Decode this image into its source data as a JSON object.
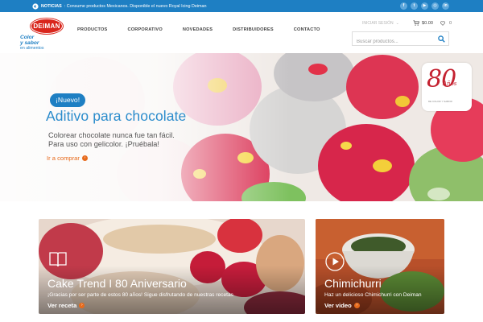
{
  "colors": {
    "brand_blue": "#1e7fc3",
    "brand_red": "#d9261c",
    "accent_orange": "#e76b1c",
    "title_blue": "#2b8ccc"
  },
  "topbar": {
    "news_label": "NOTICIAS",
    "news_text": ": Consume productos Mexicanos. Disponible el nuevo Royal Icing Deiman",
    "socials": [
      {
        "icon": "facebook-icon",
        "glyph": "f"
      },
      {
        "icon": "twitter-icon",
        "glyph": "t"
      },
      {
        "icon": "youtube-icon",
        "glyph": "▶"
      },
      {
        "icon": "instagram-icon",
        "glyph": "◎"
      },
      {
        "icon": "linkedin-icon",
        "glyph": "in"
      }
    ]
  },
  "header": {
    "logo": {
      "brand": "DEIMAN",
      "tagline_1": "Color",
      "tagline_2": "y sabor",
      "tagline_3": "en alimentos"
    },
    "nav": [
      "PRODUCTOS",
      "CORPORATIVO",
      "NOVEDADES",
      "DISTRIBUIDORES",
      "CONTACTO"
    ],
    "login_label": "INICIAR SESIÓN",
    "cart_total": "$0.00",
    "wishlist_count": "0",
    "search_placeholder": "Buscar productos..."
  },
  "hero": {
    "badge": "¡Nuevo!",
    "title": "Aditivo para chocolate",
    "text_line1": "Colorear chocolate nunca fue tan fácil.",
    "text_line2": "Para uso con gelicolor. ¡Pruébala!",
    "cta": "Ir a comprar",
    "anniversary": {
      "number": "80",
      "word": "Años",
      "small": "DE COLOR Y SABOR"
    }
  },
  "cards": [
    {
      "title": "Cake Trend I 80 Aniversario",
      "description": "¡Gracias por ser parte de estos 80 años! Sigue disfrutando de nuestras recetas",
      "link": "Ver receta",
      "icon": "book-icon"
    },
    {
      "title": "Chimichurri",
      "description": "Haz un delicioso Chimichurri con Deiman",
      "link": "Ver video",
      "icon": "play-icon"
    }
  ]
}
